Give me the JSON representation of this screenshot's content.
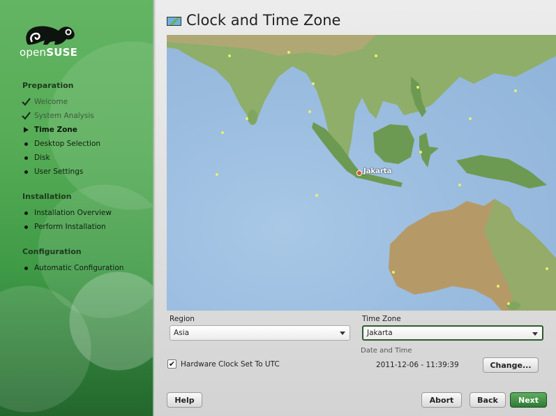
{
  "brand": {
    "logo_text_light": "open",
    "logo_text_bold": "SUSE"
  },
  "page": {
    "title": "Clock and Time Zone"
  },
  "sidebar": {
    "sections": [
      {
        "title": "Preparation"
      },
      {
        "title": "Installation"
      },
      {
        "title": "Configuration"
      }
    ],
    "steps": [
      {
        "label": "Welcome",
        "state": "done"
      },
      {
        "label": "System Analysis",
        "state": "done"
      },
      {
        "label": "Time Zone",
        "state": "current"
      },
      {
        "label": "Desktop Selection",
        "state": "pending"
      },
      {
        "label": "Disk",
        "state": "pending"
      },
      {
        "label": "User Settings",
        "state": "pending"
      },
      {
        "label": "Installation Overview",
        "state": "pending"
      },
      {
        "label": "Perform Installation",
        "state": "pending"
      },
      {
        "label": "Automatic Configuration",
        "state": "pending"
      }
    ]
  },
  "map": {
    "city_label": "Jakarta"
  },
  "region": {
    "label": "Region",
    "value": "Asia"
  },
  "timezone": {
    "label": "Time Zone",
    "value": "Jakarta"
  },
  "clock": {
    "hardware_utc_label": "Hardware Clock Set To UTC",
    "hardware_utc_checked": true,
    "date_time_label": "Date and Time",
    "date_time_value": "2011-12-06 - 11:39:39",
    "change_label": "Change..."
  },
  "buttons": {
    "help": "Help",
    "abort": "Abort",
    "back": "Back",
    "next": "Next"
  },
  "colors": {
    "accent": "#2e7a35",
    "sidebar": "#56ac56"
  }
}
